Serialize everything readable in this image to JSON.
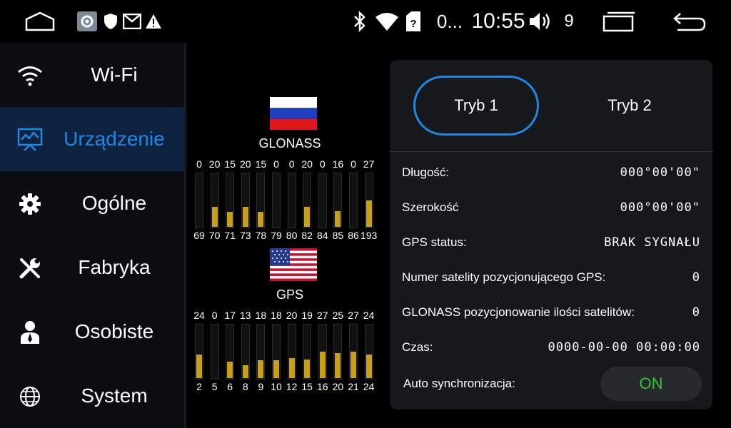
{
  "status_bar": {
    "net_label": "0...",
    "clock": "10:55",
    "volume": "9",
    "icons": [
      "home-icon",
      "settings-app-icon",
      "shield-icon",
      "mail-icon",
      "warning-icon",
      "bluetooth-icon",
      "wifi-icon",
      "sim-icon",
      "volume-icon",
      "recents-icon",
      "back-icon"
    ]
  },
  "sidebar": {
    "items": [
      {
        "label": "Wi-Fi",
        "icon": "wifi-icon"
      },
      {
        "label": "Urządzenie",
        "icon": "monitor-chart-icon"
      },
      {
        "label": "Ogólne",
        "icon": "gear-icon"
      },
      {
        "label": "Fabryka",
        "icon": "tools-icon"
      },
      {
        "label": "Osobiste",
        "icon": "person-icon"
      },
      {
        "label": "System",
        "icon": "globe-icon"
      }
    ],
    "active_index": 1
  },
  "glonass": {
    "label": "GLONASS",
    "snr": [
      "0",
      "20",
      "15",
      "20",
      "15",
      "0",
      "0",
      "20",
      "0",
      "16",
      "0",
      "27"
    ],
    "ids": [
      "69",
      "70",
      "71",
      "73",
      "78",
      "79",
      "80",
      "82",
      "84",
      "85",
      "86",
      "193"
    ],
    "levels": [
      0,
      20,
      15,
      20,
      15,
      0,
      0,
      20,
      0,
      16,
      0,
      27
    ]
  },
  "gps": {
    "label": "GPS",
    "snr": [
      "24",
      "0",
      "17",
      "13",
      "18",
      "18",
      "20",
      "19",
      "27",
      "25",
      "27",
      "24"
    ],
    "ids": [
      "2",
      "5",
      "6",
      "8",
      "9",
      "10",
      "12",
      "15",
      "16",
      "20",
      "21",
      "24"
    ],
    "levels": [
      24,
      0,
      17,
      13,
      18,
      18,
      20,
      19,
      27,
      25,
      27,
      24
    ]
  },
  "info": {
    "mode1": "Tryb 1",
    "mode2": "Tryb 2",
    "longitude_label": "Długość:",
    "longitude_value": "000°00'00\"",
    "latitude_label": "Szerokość",
    "latitude_value": "000°00'00\"",
    "gps_status_label": "GPS status:",
    "gps_status_value": "BRAK SYGNAŁU",
    "gps_sat_label": "Numer satelity pozycjonującego GPS:",
    "gps_sat_value": "0",
    "glonass_sat_label": "GLONASS pozycjonowanie ilości satelitów:",
    "glonass_sat_value": "0",
    "time_label": "Czas:",
    "time_value": "0000-00-00 00:00:00",
    "autosync_label": "Auto synchronizacja:",
    "autosync_value": "ON"
  },
  "colors": {
    "accent": "#1e88e5",
    "bar": "#c8a018",
    "on": "#34c33a",
    "active_bg": "#0f2240"
  }
}
